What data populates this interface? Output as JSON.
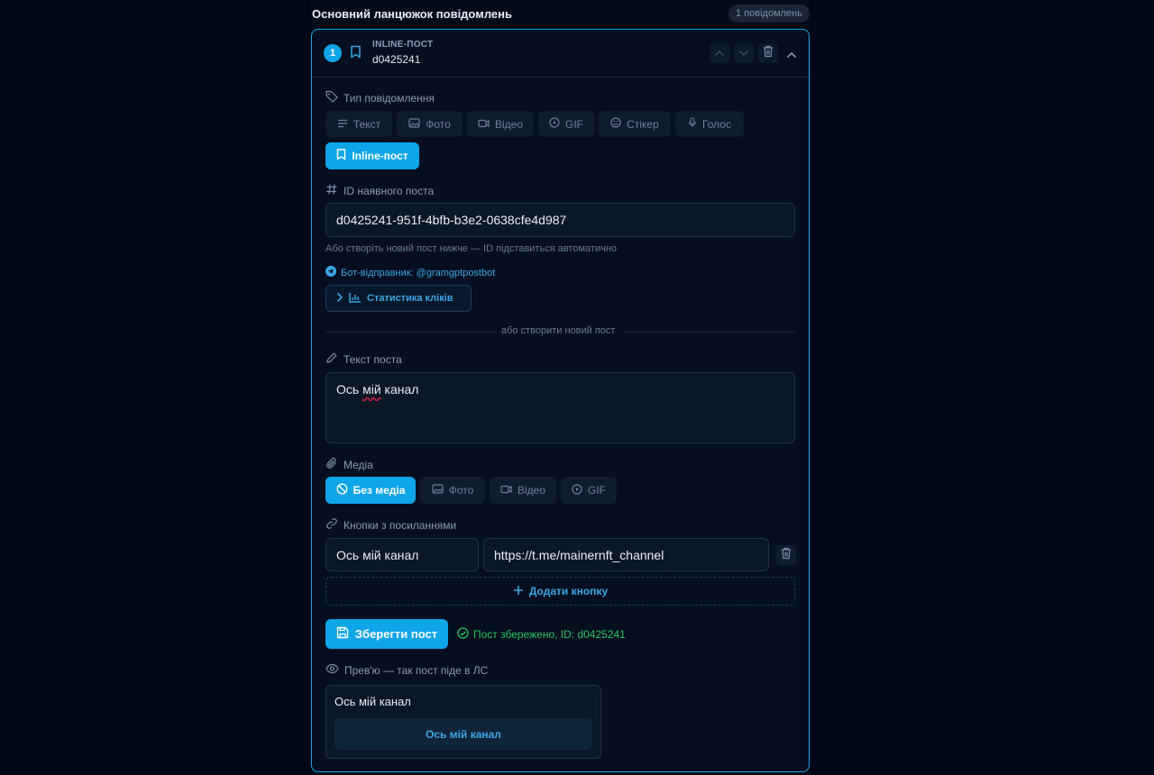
{
  "header": {
    "title": "Основний ланцюжок повідомлень",
    "count_badge": "1 повідомлень"
  },
  "card": {
    "index": "1",
    "kind": "INLINE-ПОСТ",
    "subtitle": "d0425241"
  },
  "message_type": {
    "label": "Тип повідомлення",
    "options": [
      {
        "label": "Текст",
        "icon": "text-icon"
      },
      {
        "label": "Фото",
        "icon": "image-icon"
      },
      {
        "label": "Відео",
        "icon": "video-icon"
      },
      {
        "label": "GIF",
        "icon": "play-circle-icon"
      },
      {
        "label": "Стікер",
        "icon": "smile-icon"
      },
      {
        "label": "Голос",
        "icon": "mic-icon"
      },
      {
        "label": "Inline-пост",
        "icon": "bookmark-icon",
        "active": true
      }
    ]
  },
  "post_id": {
    "label": "ID наявного поста",
    "value": "d0425241-951f-4bfb-b3e2-0638cfe4d987",
    "hint": "Або створіть новий пост нижче — ID підставиться автоматично",
    "bot_sender": "Бот-відправник: @gramgptpostbot",
    "stats_button": "Статистика кліків"
  },
  "divider": "або створити новий пост",
  "post_text": {
    "label": "Текст поста",
    "value_before": "Ось ",
    "value_misspelled": "мій",
    "value_after": " канал"
  },
  "media": {
    "label": "Медіа",
    "options": [
      {
        "label": "Без медіа",
        "icon": "ban-icon",
        "active": true
      },
      {
        "label": "Фото",
        "icon": "image-icon"
      },
      {
        "label": "Відео",
        "icon": "video-icon"
      },
      {
        "label": "GIF",
        "icon": "play-circle-icon"
      }
    ]
  },
  "link_buttons": {
    "label": "Кнопки з посиланнями",
    "rows": [
      {
        "text": "Ось мій канал",
        "url": "https://t.me/mainernft_channel"
      }
    ],
    "add_label": "Додати кнопку"
  },
  "save": {
    "label": "Зберегти пост",
    "status": "Пост збережено, ID: d0425241"
  },
  "preview": {
    "label": "Прев'ю — так пост піде в ЛС",
    "text": "Ось мій канал",
    "button": "Ось мій канал"
  },
  "colors": {
    "accent": "#0ea5e9",
    "success": "#22c55e",
    "background": "#020817"
  }
}
